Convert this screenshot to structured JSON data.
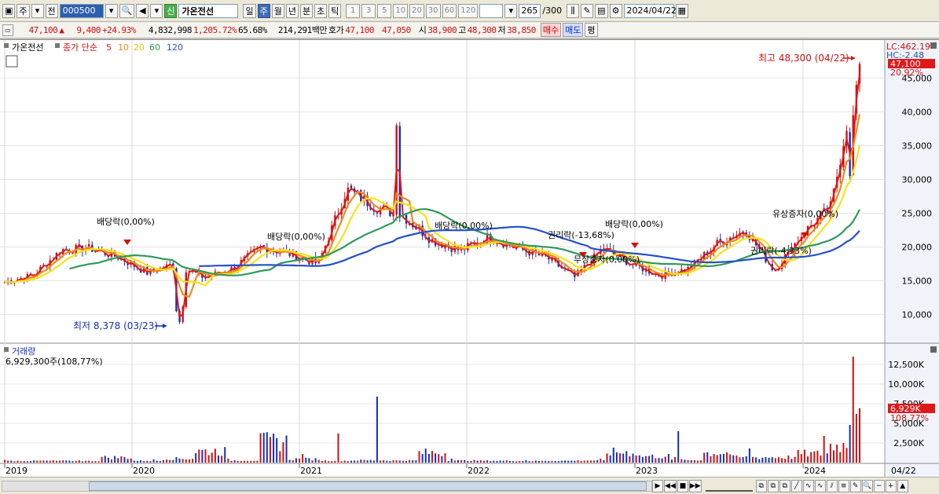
{
  "toolbar": {
    "period_type": "주",
    "prev_label": "전",
    "code": "000500",
    "new_badge": "신",
    "stock_name": "가온전선",
    "periods": [
      "일",
      "주",
      "월",
      "년",
      "분",
      "초",
      "틱"
    ],
    "active_period": "주",
    "intervals": [
      "1",
      "3",
      "5",
      "10",
      "20",
      "30",
      "60",
      "120"
    ],
    "count": "265",
    "count_max": "/300",
    "date": "2024/04/22"
  },
  "quote": {
    "price": "47,100",
    "arrow": "▲",
    "change": "9,400",
    "change_pct": "+24.93%",
    "volume": "4,832,998",
    "volume_ratio": "1,205.72%",
    "turnover": "65.68%",
    "amount": "214,291백만",
    "bid_label": "호가",
    "ask": "47,100",
    "bid": "47,050",
    "open_label": "시",
    "open": "38,900",
    "high_label": "고",
    "high": "48,300",
    "low_label": "저",
    "low": "38,850",
    "buy_label": "매수",
    "sell_label": "매도",
    "eval_label": "평"
  },
  "price_pane": {
    "legend_name": "가온전선",
    "ma_label": "종가 단순",
    "ma_periods": [
      "5",
      "10",
      "20",
      "60",
      "120"
    ],
    "ma_colors": [
      "#e01818",
      "#f08a1a",
      "#f5e31a",
      "#2e9a5a",
      "#2450c8"
    ],
    "lc": "LC:462.19",
    "hc": "HC:-2.48",
    "last_price_tag": "47,100",
    "last_pct_tag": "20.92%",
    "max_label": "최고 48,300 (04/22)",
    "min_label": "최저 8,378 (03/23)",
    "y_ticks": [
      "45,000",
      "40,000",
      "35,000",
      "30,000",
      "25,000",
      "20,000",
      "15,000",
      "10,000"
    ]
  },
  "annotations": [
    {
      "text": "배당락(0,00%)"
    },
    {
      "text": "배당락(0,00%)"
    },
    {
      "text": "배당락(0,00%)"
    },
    {
      "text": "권리락(-13,68%)"
    },
    {
      "text": "무상증자(0,00%)"
    },
    {
      "text": "배당락(0,00%)"
    },
    {
      "text": "유상증자(0,00%)"
    },
    {
      "text": "권리락(-4,33%)"
    }
  ],
  "volume_pane": {
    "title": "거래량",
    "value_text": "6,929,300주(108,77%)",
    "y_ticks": [
      "12,500K",
      "10,000K",
      "7,500K",
      "5,000K",
      "2,500K"
    ],
    "last_tag": "6,929K",
    "last_pct_tag": "108,77%"
  },
  "x_axis": {
    "labels": [
      "2019",
      "2020",
      "2021",
      "2022",
      "2023",
      "2024"
    ],
    "right_label": "04/22"
  },
  "chart_data": {
    "type": "line",
    "title": "",
    "x": [
      "2019",
      "2020",
      "2021",
      "2022",
      "2023",
      "2024"
    ],
    "series": [
      {
        "values": [
          14800,
          15800,
          19600,
          19800,
          18500,
          16200,
          17500,
          15500,
          16800,
          20000,
          19000,
          17500,
          28500,
          26000,
          24500,
          21000,
          19500,
          21500,
          19800,
          18500,
          15500,
          19800,
          17500,
          15800,
          16800,
          20500,
          22500,
          16500,
          22000,
          26000,
          48300
        ]
      }
    ],
    "ylim": [
      8000,
      48300
    ],
    "volume_values": [
      0.35,
      0.4,
      0.3,
      1.8,
      0.4,
      1.3,
      4.5,
      0.5,
      8.4,
      1.1,
      0.4,
      0.6,
      0.5,
      3.8,
      0.5,
      0.4,
      0.3,
      0.4,
      0.5,
      4.0,
      2.3,
      0.7,
      3.7,
      1.8,
      1.9,
      3.4,
      6.9,
      13.5
    ]
  }
}
